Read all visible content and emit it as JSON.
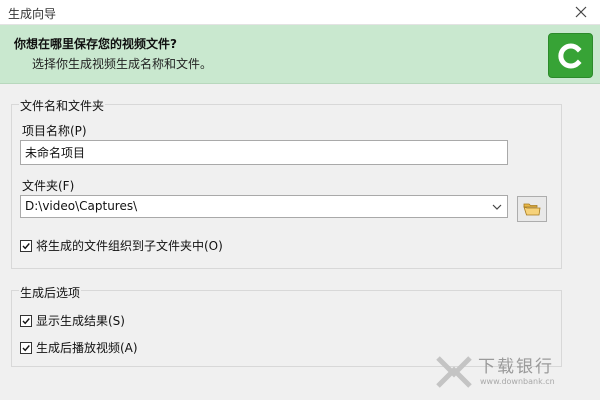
{
  "window": {
    "title": "生成向导"
  },
  "header": {
    "heading": "你想在哪里保存您的视频文件?",
    "subheading": "选择你生成视频生成名称和文件。"
  },
  "file_group": {
    "legend": "文件名和文件夹",
    "project_name_label": "项目名称(P)",
    "project_name_value": "未命名项目",
    "folder_label": "文件夹(F)",
    "folder_value": "D:\\video\\Captures\\",
    "organize_label": "将生成的文件组织到子文件夹中(O)",
    "organize_checked": true
  },
  "post_group": {
    "legend": "生成后选项",
    "show_results_label": "显示生成结果(S)",
    "show_results_checked": true,
    "play_video_label": "生成后播放视频(A)",
    "play_video_checked": true
  },
  "watermark": {
    "text": "下载银行",
    "sub": "www.downbank.cn"
  },
  "colors": {
    "header_bg": "#c9e8cf",
    "logo_green": "#37a336"
  },
  "icons": [
    "close-icon",
    "camtasia-logo-icon",
    "chevron-down-icon",
    "folder-open-icon",
    "checkmark-icon"
  ]
}
